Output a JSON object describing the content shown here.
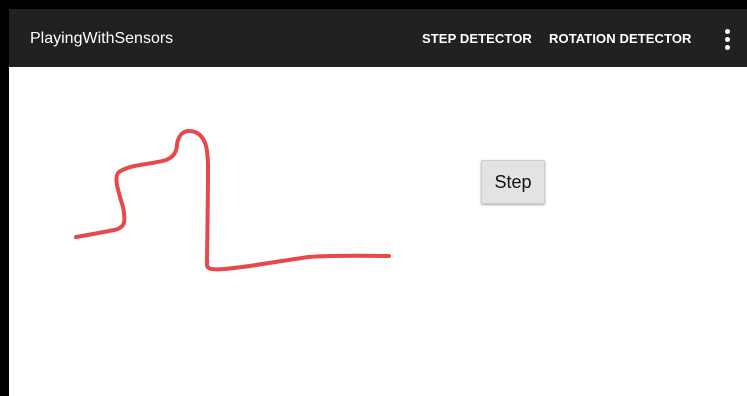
{
  "action_bar": {
    "title": "PlayingWithSensors",
    "actions": [
      {
        "label": "STEP DETECTOR"
      },
      {
        "label": "ROTATION DETECTOR"
      }
    ],
    "overflow_icon": "more-vert-icon",
    "background": "#212121"
  },
  "main": {
    "step_button_label": "Step",
    "drawing": {
      "stroke_color": "#e8474c",
      "description_icon": "freehand-stroke"
    }
  }
}
